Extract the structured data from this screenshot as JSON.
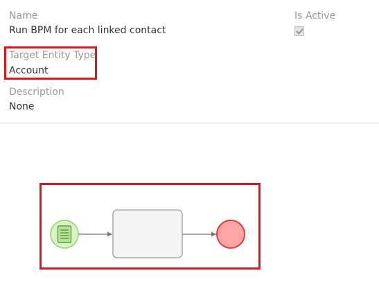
{
  "record": {
    "name_label": "Name",
    "name_value": "Run BPM for each linked contact",
    "is_active_label": "Is Active",
    "is_active_checked": true,
    "target_entity_type_label": "Target Entity Type",
    "target_entity_type_value": "Account",
    "description_label": "Description",
    "description_value": "None"
  },
  "flowchart": {
    "nodes": [
      {
        "type": "start-event",
        "icon": "task-list-icon",
        "fill": "#d6f5c3",
        "stroke": "#8fd16b"
      },
      {
        "type": "task",
        "fill": "#f4f4f4",
        "stroke": "#9e9e9e"
      },
      {
        "type": "end-event",
        "fill": "#ffa4a4",
        "stroke": "#e23c3c"
      }
    ],
    "highlight_color": "#e0141e"
  }
}
